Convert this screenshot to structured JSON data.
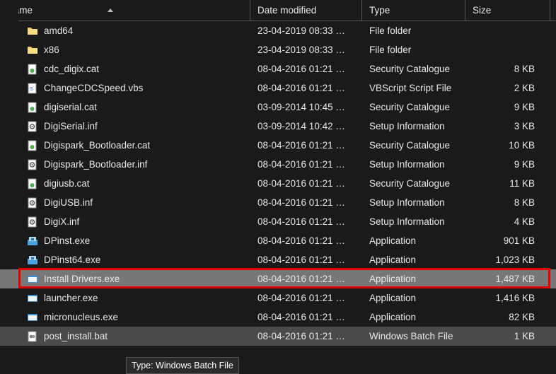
{
  "columns": {
    "name": "Name",
    "date": "Date modified",
    "type": "Type",
    "size": "Size"
  },
  "files": [
    {
      "icon": "folder",
      "name": "amd64",
      "date": "23-04-2019 08:33 …",
      "type": "File folder",
      "size": ""
    },
    {
      "icon": "folder",
      "name": "x86",
      "date": "23-04-2019 08:33 …",
      "type": "File folder",
      "size": ""
    },
    {
      "icon": "cat",
      "name": "cdc_digix.cat",
      "date": "08-04-2016 01:21 …",
      "type": "Security Catalogue",
      "size": "8 KB"
    },
    {
      "icon": "vbs",
      "name": "ChangeCDCSpeed.vbs",
      "date": "08-04-2016 01:21 …",
      "type": "VBScript Script File",
      "size": "2 KB"
    },
    {
      "icon": "cat",
      "name": "digiserial.cat",
      "date": "03-09-2014 10:45 …",
      "type": "Security Catalogue",
      "size": "9 KB"
    },
    {
      "icon": "inf",
      "name": "DigiSerial.inf",
      "date": "03-09-2014 10:42 …",
      "type": "Setup Information",
      "size": "3 KB"
    },
    {
      "icon": "cat",
      "name": "Digispark_Bootloader.cat",
      "date": "08-04-2016 01:21 …",
      "type": "Security Catalogue",
      "size": "10 KB"
    },
    {
      "icon": "inf",
      "name": "Digispark_Bootloader.inf",
      "date": "08-04-2016 01:21 …",
      "type": "Setup Information",
      "size": "9 KB"
    },
    {
      "icon": "cat",
      "name": "digiusb.cat",
      "date": "08-04-2016 01:21 …",
      "type": "Security Catalogue",
      "size": "11 KB"
    },
    {
      "icon": "inf",
      "name": "DigiUSB.inf",
      "date": "08-04-2016 01:21 …",
      "type": "Setup Information",
      "size": "8 KB"
    },
    {
      "icon": "inf",
      "name": "DigiX.inf",
      "date": "08-04-2016 01:21 …",
      "type": "Setup Information",
      "size": "4 KB"
    },
    {
      "icon": "exe2",
      "name": "DPinst.exe",
      "date": "08-04-2016 01:21 …",
      "type": "Application",
      "size": "901 KB"
    },
    {
      "icon": "exe2",
      "name": "DPinst64.exe",
      "date": "08-04-2016 01:21 …",
      "type": "Application",
      "size": "1,023 KB"
    },
    {
      "icon": "exe",
      "name": "Install Drivers.exe",
      "date": "08-04-2016 01:21 …",
      "type": "Application",
      "size": "1,487 KB"
    },
    {
      "icon": "exe",
      "name": "launcher.exe",
      "date": "08-04-2016 01:21 …",
      "type": "Application",
      "size": "1,416 KB"
    },
    {
      "icon": "exe",
      "name": "micronucleus.exe",
      "date": "08-04-2016 01:21 …",
      "type": "Application",
      "size": "82 KB"
    },
    {
      "icon": "bat",
      "name": "post_install.bat",
      "date": "08-04-2016 01:21 …",
      "type": "Windows Batch File",
      "size": "1 KB"
    }
  ],
  "selected_index": 13,
  "hover_index": 16,
  "highlight_index": 13,
  "tooltip": "Type: Windows Batch File"
}
